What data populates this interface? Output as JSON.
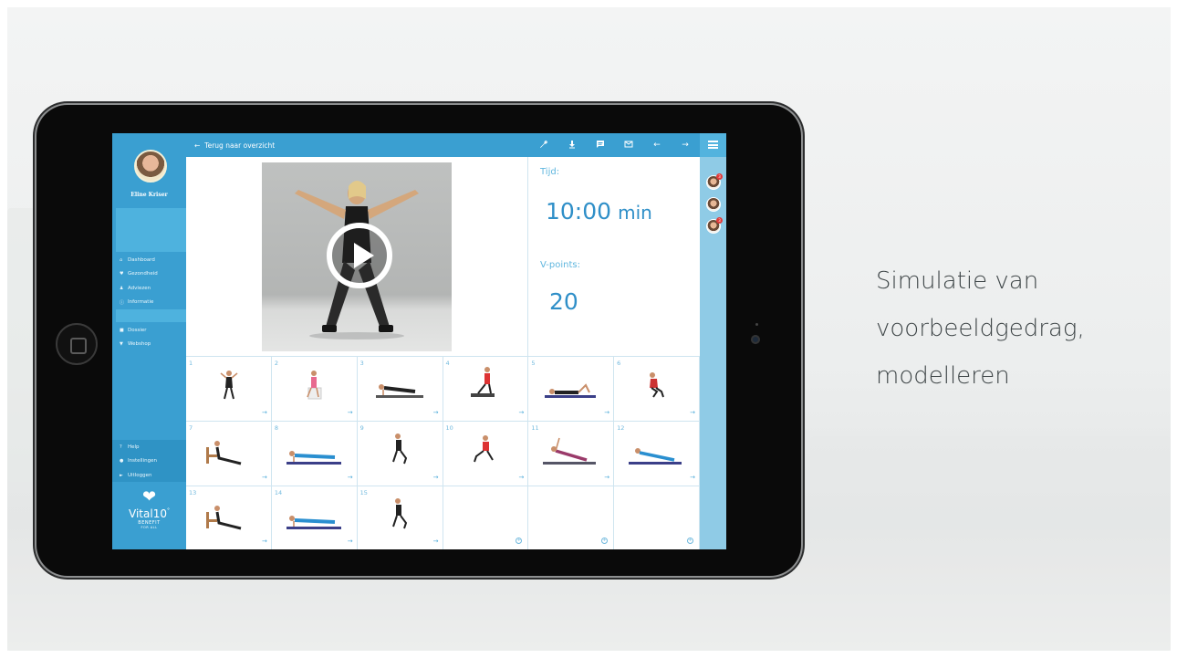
{
  "caption": {
    "line1": "Simulatie van",
    "line2": "voorbeeldgedrag,",
    "line3": "modelleren"
  },
  "app": {
    "user_name": "Eline Kriser",
    "nav": [
      {
        "icon": "home-icon",
        "glyph": "⌂",
        "label": "Dashboard"
      },
      {
        "icon": "heart-icon",
        "glyph": "♥",
        "label": "Gezondheid"
      },
      {
        "icon": "person-icon",
        "glyph": "♟",
        "label": "Adviezen"
      },
      {
        "icon": "info-icon",
        "glyph": "ⓘ",
        "label": "Informatie"
      },
      {
        "icon": "file-icon",
        "glyph": "■",
        "label": "Dossier"
      },
      {
        "icon": "cart-icon",
        "glyph": "▼",
        "label": "Webshop"
      }
    ],
    "nav_bottom": [
      {
        "icon": "help-icon",
        "glyph": "?",
        "label": "Help"
      },
      {
        "icon": "settings-icon",
        "glyph": "●",
        "label": "Instellingen"
      },
      {
        "icon": "logout-icon",
        "glyph": "►",
        "label": "Uitloggen"
      }
    ],
    "logo": {
      "text": "Vital10",
      "reg": "°",
      "sub": "BENEFIT",
      "sub2": "FOR ALL"
    },
    "topbar": {
      "back_label": "Terug naar overzicht",
      "icons": [
        "wrench-icon",
        "download-icon",
        "chat-icon",
        "mail-icon",
        "arrow-left-icon",
        "arrow-right-icon"
      ]
    },
    "stats": {
      "time_label": "Tijd:",
      "time_value": "10:00",
      "time_unit": "min",
      "points_label": "V-points:",
      "points_value": "20"
    },
    "exercises": [
      {
        "num": "1"
      },
      {
        "num": "2"
      },
      {
        "num": "3"
      },
      {
        "num": "4"
      },
      {
        "num": "5"
      },
      {
        "num": "6"
      },
      {
        "num": "7"
      },
      {
        "num": "8"
      },
      {
        "num": "9"
      },
      {
        "num": "10"
      },
      {
        "num": "11"
      },
      {
        "num": "12"
      },
      {
        "num": "13"
      },
      {
        "num": "14"
      },
      {
        "num": "15"
      },
      {
        "num": ""
      },
      {
        "num": ""
      },
      {
        "num": ""
      }
    ],
    "notification_badges": [
      "3",
      "",
      "3"
    ]
  },
  "colors": {
    "primary": "#3a9fd1",
    "accent_text": "#2f8fc8",
    "rail": "#8fcbe6",
    "caption": "#3f4648"
  }
}
